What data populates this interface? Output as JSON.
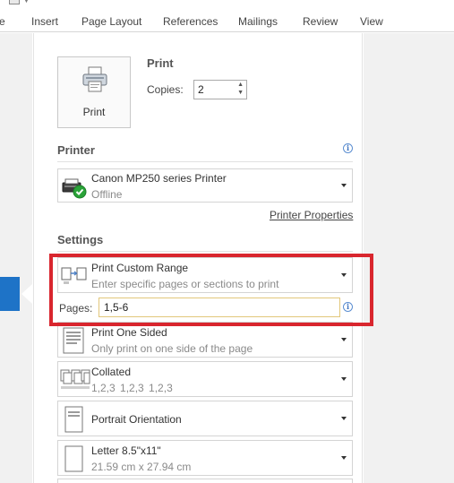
{
  "ribbon": {
    "tabs": [
      "e",
      "Insert",
      "Page Layout",
      "References",
      "Mailings",
      "Review",
      "View"
    ]
  },
  "print": {
    "button_label": "Print",
    "title": "Print",
    "copies_label": "Copies:",
    "copies_value": "2"
  },
  "printer": {
    "heading": "Printer",
    "name": "Canon MP250 series Printer",
    "status": "Offline",
    "properties_link": "Printer Properties"
  },
  "settings": {
    "heading": "Settings",
    "range_title": "Print Custom Range",
    "range_sub": "Enter specific pages or sections to print",
    "pages_label": "Pages:",
    "pages_value": "1,5-6",
    "sided_title": "Print One Sided",
    "sided_sub": "Only print on one side of the page",
    "collate_title": "Collated",
    "collate_sub": "1,2,3    1,2,3    1,2,3",
    "orientation_title": "Portrait Orientation",
    "paper_title": "Letter 8.5\"x11\"",
    "paper_sub": "21.59 cm x 27.94 cm"
  },
  "colors": {
    "accent": "#1e73c7",
    "highlight": "#d9262e",
    "status_ok": "#2aa338"
  }
}
